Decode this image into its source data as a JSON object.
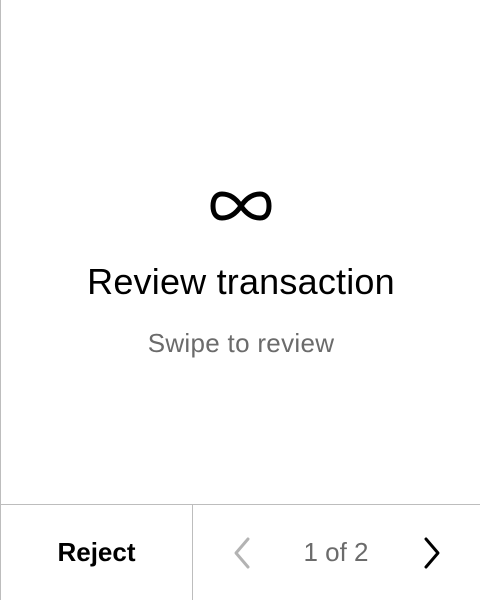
{
  "review": {
    "icon": "infinity-icon",
    "title": "Review transaction",
    "subtitle": "Swipe to review"
  },
  "footer": {
    "reject_label": "Reject",
    "page_indicator": "1 of 2",
    "prev_icon": "chevron-left-icon",
    "next_icon": "chevron-right-icon"
  },
  "colors": {
    "text": "#000000",
    "muted_text": "#6b6b6b",
    "divider": "#bdbdbd",
    "disabled_icon": "#b3b3b3"
  }
}
